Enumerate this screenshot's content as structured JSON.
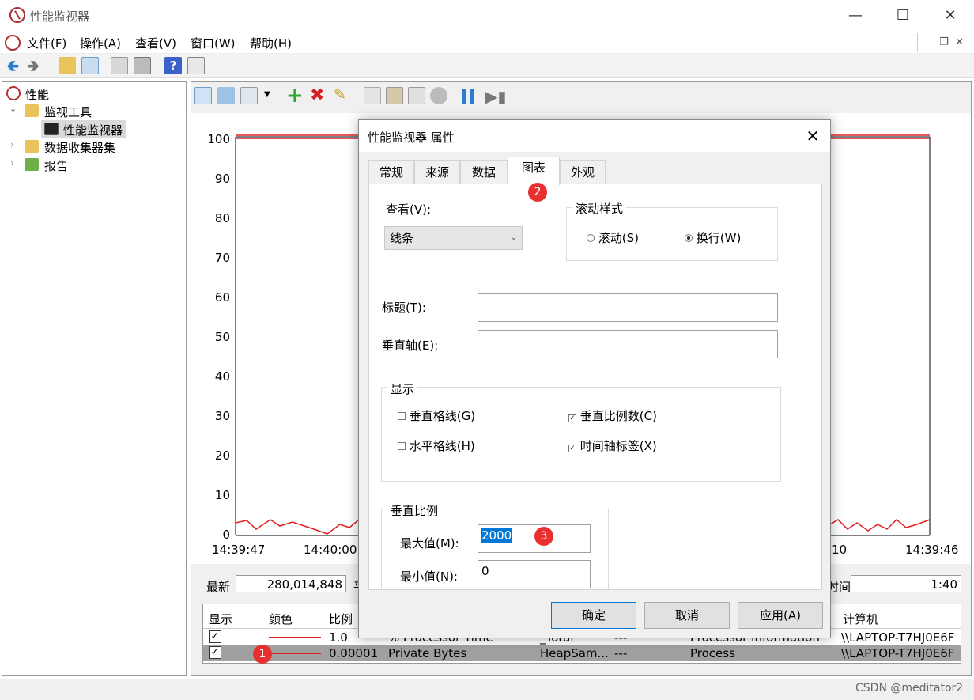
{
  "window": {
    "title": "性能监视器"
  },
  "menu": {
    "items": [
      "文件(F)",
      "操作(A)",
      "查看(V)",
      "窗口(W)",
      "帮助(H)"
    ]
  },
  "tree": {
    "root": "性能",
    "monitor_tools": "监视工具",
    "perf_monitor": "性能监视器",
    "data_collector": "数据收集器集",
    "reports": "报告"
  },
  "chart": {
    "yticks": [
      "100",
      "90",
      "80",
      "70",
      "60",
      "50",
      "40",
      "30",
      "20",
      "10",
      "0"
    ],
    "xtick_left": "14:39:47",
    "xtick_mid": "14:40:00",
    "xtick_right_partial": "10",
    "xtick_right": "14:39:46"
  },
  "stats": {
    "latest_label": "最新",
    "latest_value": "280,014,848",
    "avg_partial": "平",
    "duration_partial": "时间",
    "duration_value": "1:40"
  },
  "counters": {
    "headers": {
      "show": "显示",
      "color": "颜色",
      "scale": "比例",
      "computer": "计算机"
    },
    "row1": {
      "scale": "1.0",
      "counter": "% Processor Time",
      "instance": "_Total",
      "parent": "---",
      "object": "Processor Information",
      "computer": "\\\\LAPTOP-T7HJ0E6F",
      "color": "#e02020"
    },
    "row2": {
      "scale": "0.00001",
      "counter": "Private Bytes",
      "instance": "HeapSam...",
      "parent": "---",
      "object": "Process",
      "computer": "\\\\LAPTOP-T7HJ0E6F",
      "color": "#e02020"
    }
  },
  "dialog": {
    "title": "性能监视器 属性",
    "tabs": [
      "常规",
      "来源",
      "数据",
      "图表",
      "外观"
    ],
    "view_label": "查看(V):",
    "view_value": "线条",
    "scroll_style_label": "滚动样式",
    "scroll_option": "滚动(S)",
    "wrap_option": "换行(W)",
    "title_label": "标题(T):",
    "title_value": "",
    "vaxis_label": "垂直轴(E):",
    "vaxis_value": "",
    "display_group": "显示",
    "vgrid": "垂直格线(G)",
    "hgrid": "水平格线(H)",
    "vscale_numbers": "垂直比例数(C)",
    "time_labels": "时间轴标签(X)",
    "vscale_group": "垂直比例",
    "max_label": "最大值(M):",
    "max_value": "2000",
    "min_label": "最小值(N):",
    "min_value": "0",
    "ok": "确定",
    "cancel": "取消",
    "apply": "应用(A)"
  },
  "badges": {
    "b1": "1",
    "b2": "2",
    "b3": "3"
  },
  "watermark": "CSDN @meditator2",
  "colors": {
    "accent": "#0078d7",
    "badge": "#e83030",
    "series": "#e02020",
    "select_row": "#a0a0a0"
  }
}
